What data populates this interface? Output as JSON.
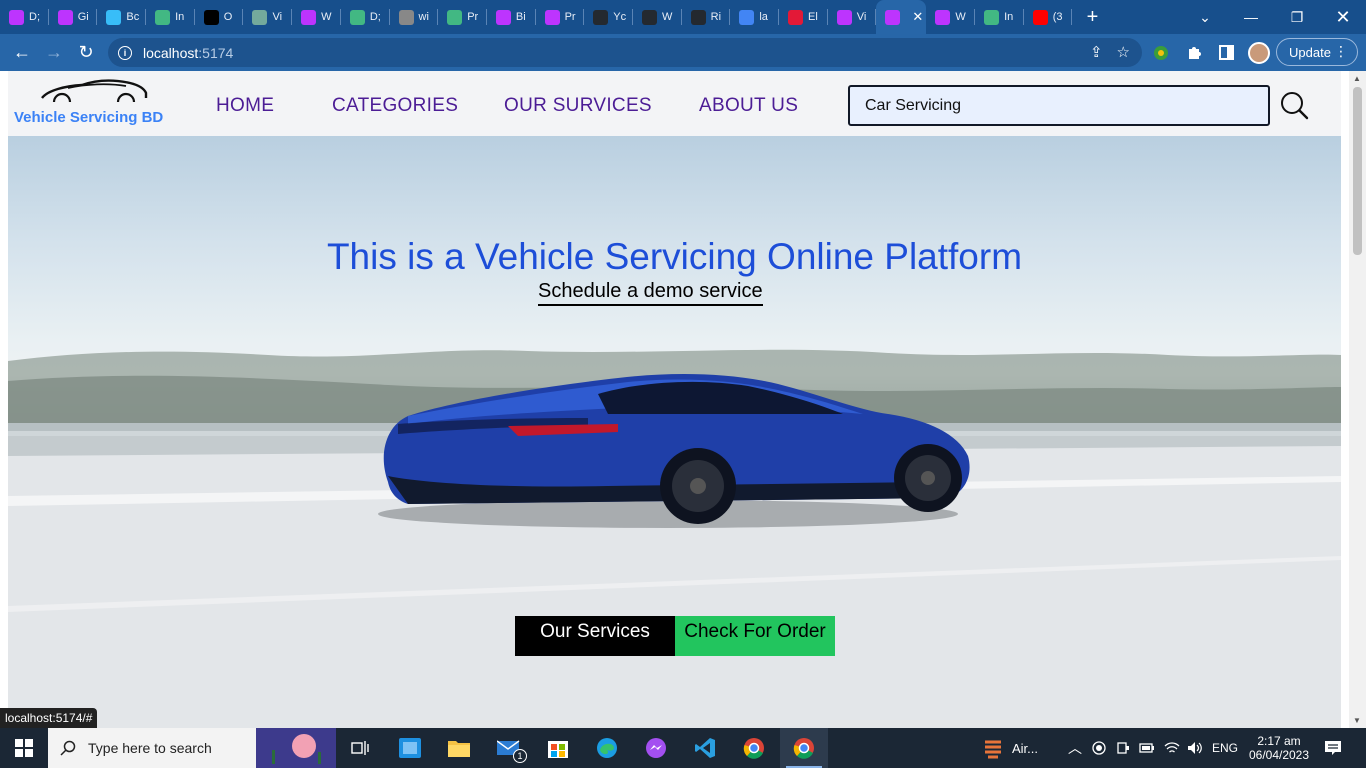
{
  "browser": {
    "tabs": [
      {
        "label": "D;",
        "icon": "vite-icon",
        "color": "#bd34fe"
      },
      {
        "label": "Gi",
        "icon": "vite-icon",
        "color": "#bd34fe"
      },
      {
        "label": "Bc",
        "icon": "tailwind-icon",
        "color": "#38bdf8"
      },
      {
        "label": "In",
        "icon": "vue-icon",
        "color": "#42b883"
      },
      {
        "label": "O",
        "icon": "openai-icon",
        "color": "#000000"
      },
      {
        "label": "Vi",
        "icon": "chatgpt-icon",
        "color": "#74aa9c"
      },
      {
        "label": "W",
        "icon": "vite-icon",
        "color": "#bd34fe"
      },
      {
        "label": "D;",
        "icon": "vue-icon",
        "color": "#42b883"
      },
      {
        "label": "wi",
        "icon": "globe-icon",
        "color": "#888888"
      },
      {
        "label": "Pr",
        "icon": "vue-icon",
        "color": "#42b883"
      },
      {
        "label": "Bi",
        "icon": "vite-icon",
        "color": "#bd34fe"
      },
      {
        "label": "Pr",
        "icon": "vite-icon",
        "color": "#bd34fe"
      },
      {
        "label": "Yc",
        "icon": "github-icon",
        "color": "#24292f"
      },
      {
        "label": "W",
        "icon": "github-icon",
        "color": "#24292f"
      },
      {
        "label": "Ri",
        "icon": "github-icon",
        "color": "#24292f"
      },
      {
        "label": "la",
        "icon": "google-icon",
        "color": "#4285f4"
      },
      {
        "label": "El",
        "icon": "tesla-icon",
        "color": "#e31937"
      },
      {
        "label": "Vi",
        "icon": "vite-icon",
        "color": "#bd34fe"
      },
      {
        "label": "",
        "icon": "vite-icon",
        "color": "#bd34fe",
        "active": true
      },
      {
        "label": "W",
        "icon": "vite-icon",
        "color": "#bd34fe"
      },
      {
        "label": "In",
        "icon": "vue-icon",
        "color": "#42b883"
      },
      {
        "label": "(3",
        "icon": "youtube-icon",
        "color": "#ff0000"
      }
    ],
    "url_host": "localhost",
    "url_port": ":5174",
    "update_label": "Update",
    "status_url": "localhost:5174/#",
    "accent": "#2766a8"
  },
  "site": {
    "brand": "Vehicle Servicing BD",
    "nav": [
      "HOME",
      "CATEGORIES",
      "OUR SURVICES",
      "ABOUT US"
    ],
    "search_value": "Car Servicing",
    "hero_title": "This is a Vehicle Servicing Online Platform",
    "hero_link": "Schedule a demo service",
    "btn_services": "Our Services",
    "btn_order": "Check For Order",
    "colors": {
      "brand": "#3b82f6",
      "nav": "#4c1d95",
      "title": "#1d4ed8",
      "order_btn": "#22c55e"
    }
  },
  "taskbar": {
    "search_placeholder": "Type here to search",
    "weather_label": "Air...",
    "language": "ENG",
    "time": "2:17 am",
    "date": "06/04/2023",
    "mail_badge": "1"
  }
}
